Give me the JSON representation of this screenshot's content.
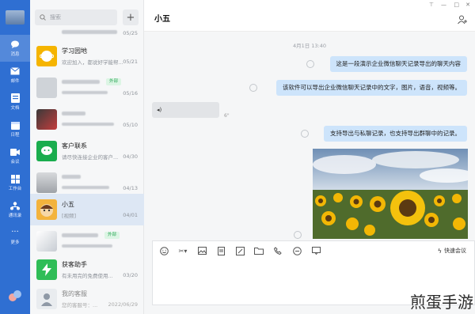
{
  "rail": {
    "items": [
      {
        "label": "消息",
        "icon": "chat-bubble-icon"
      },
      {
        "label": "邮件",
        "icon": "mail-icon"
      },
      {
        "label": "文档",
        "icon": "document-icon"
      },
      {
        "label": "日程",
        "icon": "calendar-icon"
      },
      {
        "label": "会议",
        "icon": "video-icon"
      },
      {
        "label": "工作台",
        "icon": "grid-icon"
      },
      {
        "label": "通讯录",
        "icon": "contacts-icon"
      },
      {
        "label": "更多",
        "icon": "more-icon"
      }
    ]
  },
  "search": {
    "placeholder": "搜索"
  },
  "list": {
    "rows": [
      {
        "name": "学习园地",
        "sub": "欢迎加入，都说好学能帮...",
        "date": "05/21"
      },
      {
        "name": "",
        "sub": "",
        "date": "05/16",
        "tag": "外部"
      },
      {
        "name": "",
        "sub": "",
        "date": "05/10"
      },
      {
        "name": "客户联系",
        "sub": "请尽快连接企业的客户...",
        "date": "04/30"
      },
      {
        "name": "",
        "sub": "",
        "date": "04/13"
      },
      {
        "name": "小五",
        "sub": "[视频]",
        "date": "04/01"
      },
      {
        "name": "",
        "sub": "",
        "date": "",
        "tag": "外部"
      },
      {
        "name": "获客助手",
        "sub": "有未用完的免费使用...",
        "date": "03/20"
      },
      {
        "name": "我的客服",
        "sub": "您的客服号：...",
        "date": "2022/06/29"
      }
    ],
    "top_partial_date": "05/25"
  },
  "chat": {
    "title": "小五",
    "timestamp": "4月1日 13:40",
    "messages": [
      "这是一段演示企业微信聊天记录导出的聊天内容",
      "该软件可以导出企业微信聊天记录中的文字，图片，语音，视频等。",
      "支持导出与私聊记录，也支持导出群聊中的记录。"
    ],
    "voice_icon": "◂)",
    "voice_length": "6\""
  },
  "composer": {
    "quick_meeting": "快速会议"
  },
  "watermark": "煎蛋手游",
  "colors": {
    "rail": "#2f6fd2",
    "bubble": "#cde4fb",
    "active_row": "#dde7f4"
  }
}
